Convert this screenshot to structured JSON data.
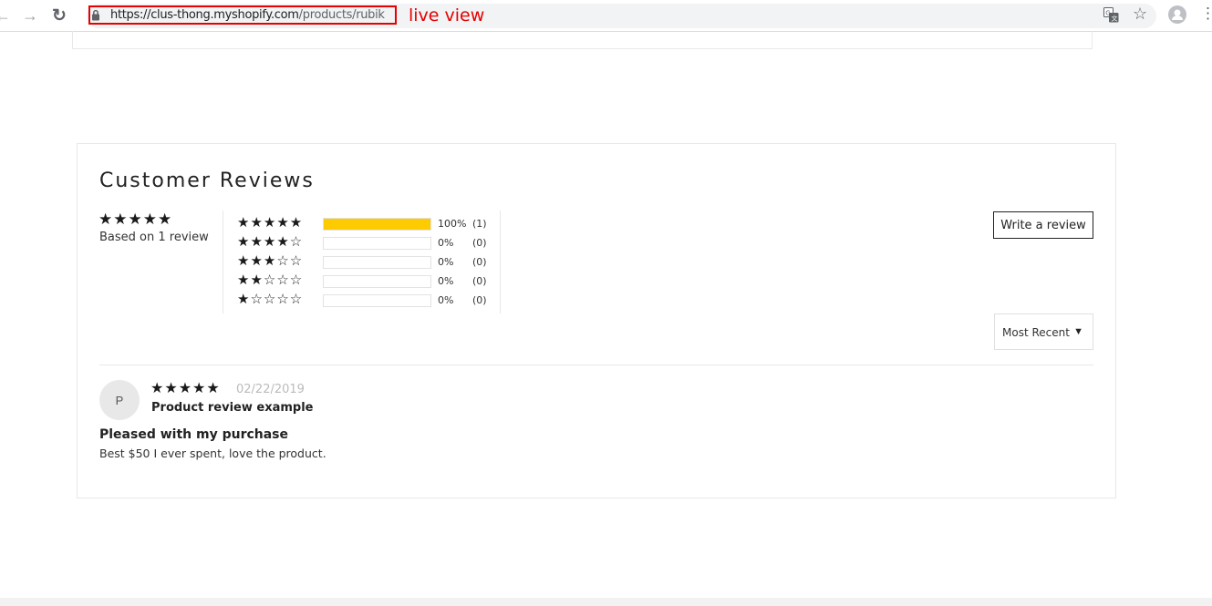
{
  "browser": {
    "url_domain": "https://clus-thong.myshopify.com",
    "url_path": "/products/rubik",
    "annotation": "live view",
    "back_glyph": "←",
    "forward_glyph": "→",
    "reload_glyph": "↻",
    "bookmark_glyph": "☆",
    "menu_glyph": "⋮"
  },
  "reviews": {
    "title": "Customer Reviews",
    "average_stars": "★★★★★",
    "based_on": "Based on 1 review",
    "histogram": [
      {
        "stars": "★★★★★",
        "fill_percent": 100,
        "percent_label": "100%",
        "count_label": "(1)"
      },
      {
        "stars": "★★★★☆",
        "fill_percent": 0,
        "percent_label": "0%",
        "count_label": "(0)"
      },
      {
        "stars": "★★★☆☆",
        "fill_percent": 0,
        "percent_label": "0%",
        "count_label": "(0)"
      },
      {
        "stars": "★★☆☆☆",
        "fill_percent": 0,
        "percent_label": "0%",
        "count_label": "(0)"
      },
      {
        "stars": "★☆☆☆☆",
        "fill_percent": 0,
        "percent_label": "0%",
        "count_label": "(0)"
      }
    ],
    "write_button": "Write a review",
    "sort": {
      "selected": "Most Recent",
      "caret": "▼"
    },
    "items": [
      {
        "avatar_initial": "P",
        "stars": "★★★★★",
        "date": "02/22/2019",
        "author": "Product review example",
        "title": "Pleased with my purchase",
        "body": "Best $50 I ever spent, love the product."
      }
    ]
  },
  "colors": {
    "star": "#1a1a1a",
    "bar_fill": "#fecb00",
    "annotation_red": "#e60000"
  }
}
